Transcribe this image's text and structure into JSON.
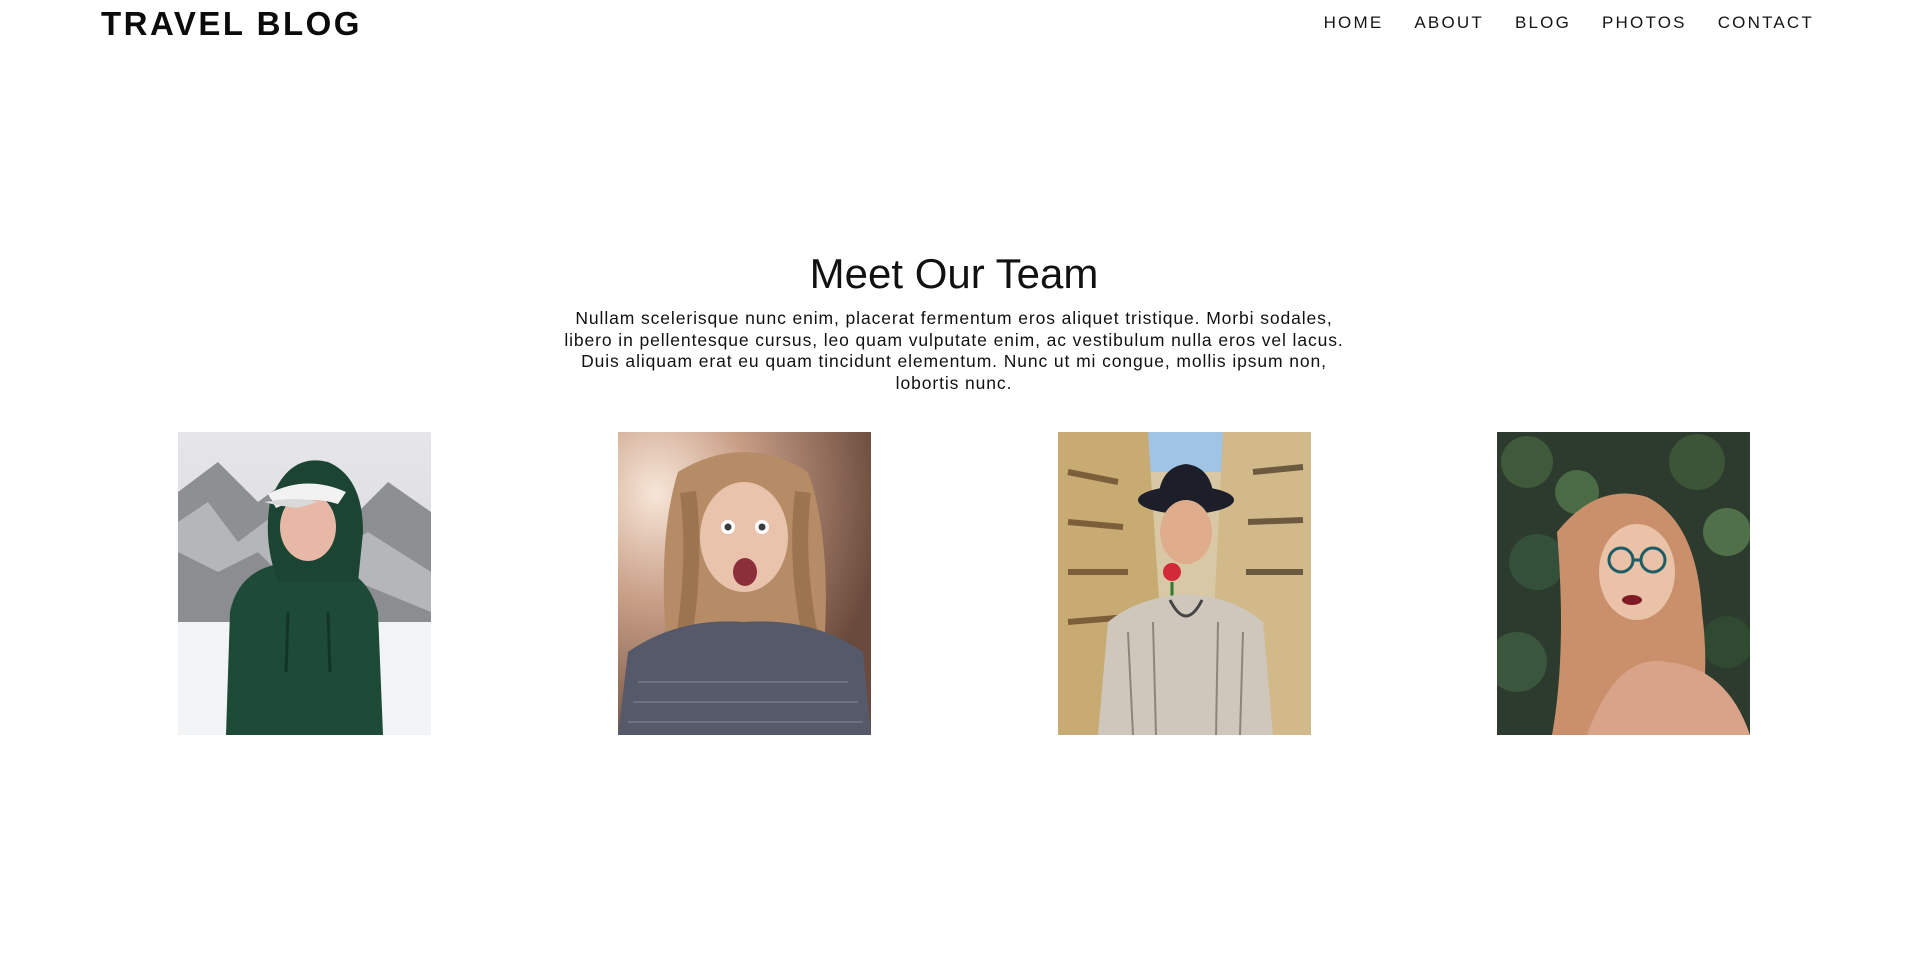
{
  "header": {
    "logo": "TRAVEL BLOG",
    "nav": [
      "HOME",
      "ABOUT",
      "BLOG",
      "PHOTOS",
      "CONTACT"
    ]
  },
  "team": {
    "title": "Meet Our Team",
    "description": "Nullam scelerisque nunc enim, placerat fermentum eros aliquet tristique. Morbi sodales, libero in pellentesque cursus, leo quam vulputate enim, ac vestibulum nulla eros vel lacus. Duis aliquam erat eu quam tincidunt elementum. Nunc ut mi congue, mollis ipsum non, lobortis nunc."
  },
  "colors": {
    "background": "#ffffff",
    "text": "#111111"
  }
}
